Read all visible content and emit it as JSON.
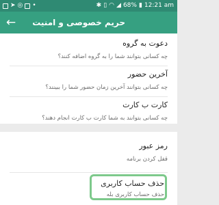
{
  "status_bar": {
    "time": "12:21 am",
    "battery": "68%"
  },
  "app_bar": {
    "title": "حریم خصوصی و امنیت",
    "back_icon": "back-arrow-icon"
  },
  "settings": [
    {
      "title": "دعوت به گروه",
      "desc": [
        "چه کسانی بتوانند شما را به گروه اضافه کنند؟"
      ]
    },
    {
      "title": "آخرین حضور",
      "desc": [
        "چه کسانی بتوانند آخرین زمان حضور شما را ببینند؟"
      ]
    },
    {
      "title": "کارت ب کارت",
      "desc": [
        "چه کسانی بتوانند به شما کارت ب کارت انجام دهند؟"
      ]
    },
    {
      "title": "رمز عبور",
      "desc": [
        "قفل کردن برنامه"
      ]
    },
    {
      "title": "حذف حساب کاربری",
      "desc": [
        "حذف حساب کاربری بله"
      ]
    }
  ]
}
